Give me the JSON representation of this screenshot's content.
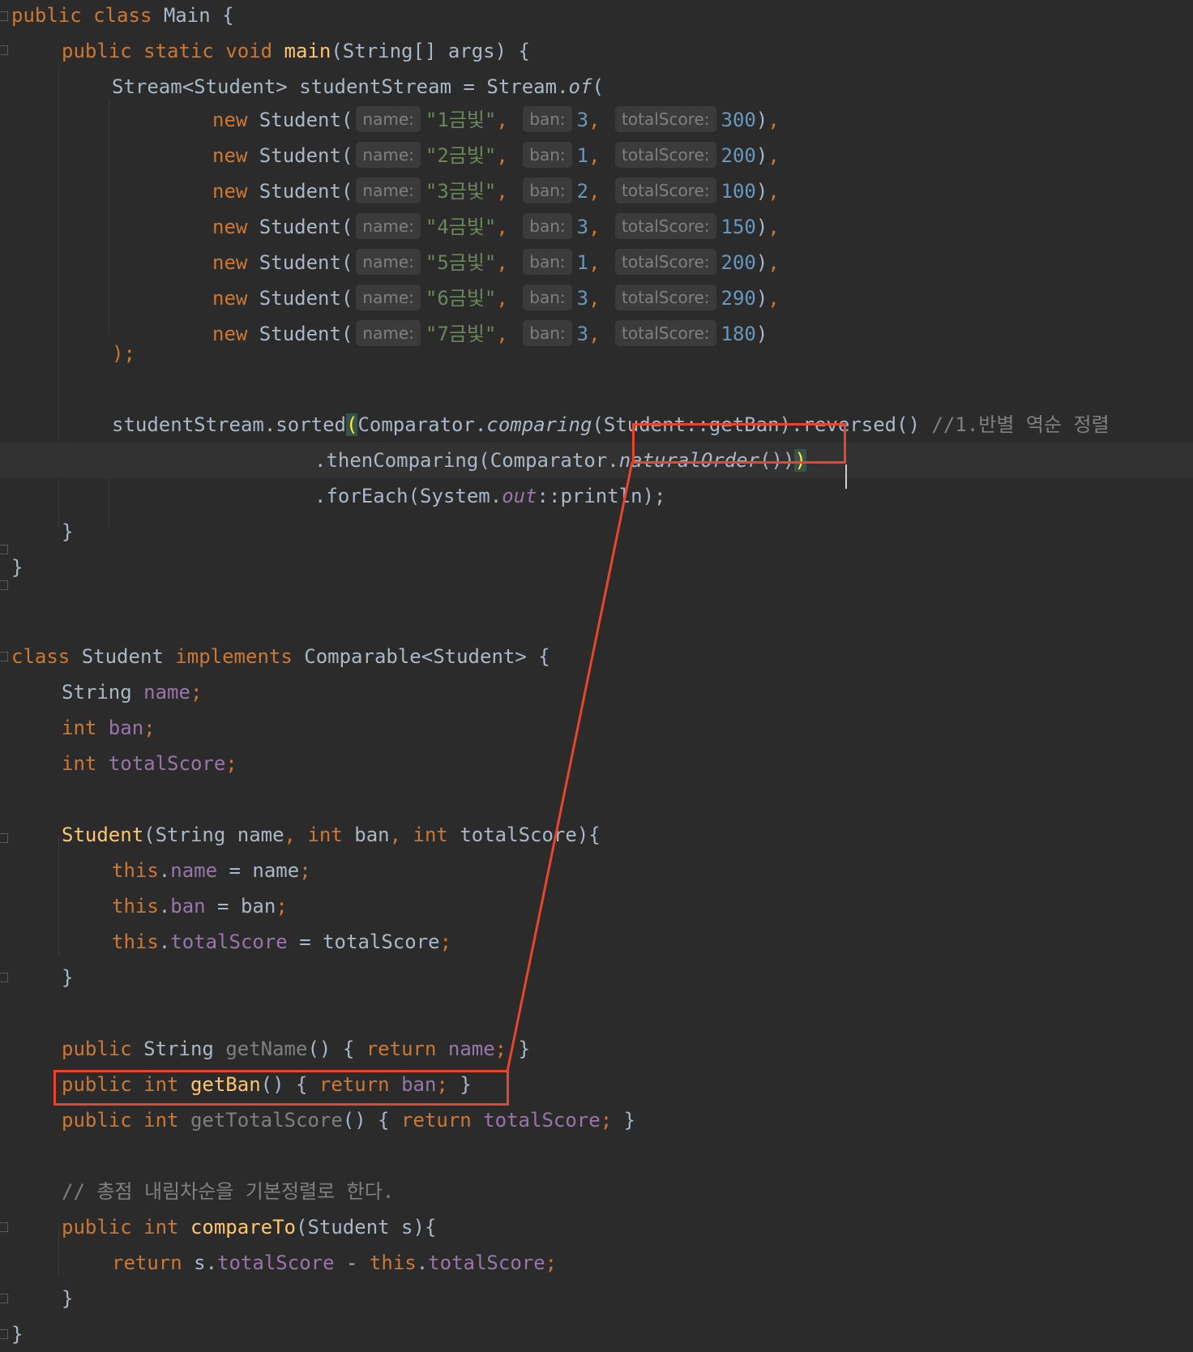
{
  "code": {
    "main_class_decl": {
      "kw": "public class ",
      "name": "Main",
      "open": " {"
    },
    "main_method": {
      "kw": "public static void ",
      "name": "main",
      "params": "(String[] args) {"
    },
    "stream_decl": {
      "lhs": "Stream<Student> studentStream = Stream.",
      "of": "of",
      "open": "("
    },
    "hints": {
      "name": "name:",
      "ban": "ban:",
      "totalScore": "totalScore:"
    },
    "student_ctor_calls": [
      {
        "kw": "new",
        "ctor": " Student(",
        "name": "\"1금빛\"",
        "ban": "3",
        "score": "300",
        "end": "),"
      },
      {
        "kw": "new",
        "ctor": " Student(",
        "name": "\"2금빛\"",
        "ban": "1",
        "score": "200",
        "end": "),"
      },
      {
        "kw": "new",
        "ctor": " Student(",
        "name": "\"3금빛\"",
        "ban": "2",
        "score": "100",
        "end": "),"
      },
      {
        "kw": "new",
        "ctor": " Student(",
        "name": "\"4금빛\"",
        "ban": "3",
        "score": "150",
        "end": "),"
      },
      {
        "kw": "new",
        "ctor": " Student(",
        "name": "\"5금빛\"",
        "ban": "1",
        "score": "200",
        "end": "),"
      },
      {
        "kw": "new",
        "ctor": " Student(",
        "name": "\"6금빛\"",
        "ban": "3",
        "score": "290",
        "end": "),"
      },
      {
        "kw": "new",
        "ctor": " Student(",
        "name": "\"7금빛\"",
        "ban": "3",
        "score": "180",
        "end": ")"
      }
    ],
    "stream_close": ");",
    "sorted_line": {
      "head": "studentStream.sorted",
      "paren": "(",
      "comparator": "Comparator.",
      "comparing": "comparing",
      "ref": "(Student::getBan)",
      "reversed": ".reversed() ",
      "comment": "//1.반별 역순 정렬"
    },
    "then_line": {
      "head": ".thenComparing(Comparator.",
      "natural": "naturalOrder",
      "tail": "())",
      "paren": ")"
    },
    "foreach_line": {
      "head": ".forEach(System.",
      "out": "out",
      "tail": "::println);"
    },
    "close_brace": "}",
    "student_class_decl": {
      "kw1": "class ",
      "name": "Student ",
      "kw2": "implements ",
      "iface": "Comparable<Student> {"
    },
    "fields": [
      {
        "type": "String ",
        "name": "name",
        "end": ";"
      },
      {
        "type": "int ",
        "name": "ban",
        "end": ";"
      },
      {
        "type": "int ",
        "name": "totalScore",
        "end": ";"
      }
    ],
    "ctor_decl": {
      "name": "Student",
      "p1": "(String name",
      "c1": ", ",
      "kw1": "int",
      "p2": " ban",
      "c2": ", ",
      "kw2": "int",
      "p3": " totalScore){"
    },
    "ctor_body": [
      {
        "this": "this",
        "dot": ".",
        "field": "name",
        "rhs": " = name",
        "end": ";"
      },
      {
        "this": "this",
        "dot": ".",
        "field": "ban",
        "rhs": " = ban",
        "end": ";"
      },
      {
        "this": "this",
        "dot": ".",
        "field": "totalScore",
        "rhs": " = totalScore",
        "end": ";"
      }
    ],
    "getters": [
      {
        "kw": "public ",
        "type": "String ",
        "name": "getName",
        "mid": "() { ",
        "ret": "return ",
        "field": "name",
        "end": "; }"
      },
      {
        "kw": "public int ",
        "type": "",
        "name": "getBan",
        "mid": "() { ",
        "ret": "return ",
        "field": "ban",
        "end": "; }"
      },
      {
        "kw": "public int ",
        "type": "",
        "name": "getTotalScore",
        "mid": "() { ",
        "ret": "return ",
        "field": "totalScore",
        "end": "; }"
      }
    ],
    "compare_comment": "// 총점 내림차순을 기본정렬로 한다.",
    "compare_decl": {
      "kw": "public int ",
      "name": "compareTo",
      "params": "(Student s){"
    },
    "compare_body": {
      "ret": "return ",
      "s": "s.",
      "f1": "totalScore",
      "minus": " - ",
      "this": "this",
      "dot": ".",
      "f2": "totalScore",
      "end": ";"
    }
  },
  "colors": {
    "background": "#2b2b2b",
    "keyword": "#cc7832",
    "method": "#ffc66d",
    "string": "#6a8759",
    "number": "#6897bb",
    "field": "#9876aa",
    "text": "#a9b7c6",
    "comment": "#808080",
    "annotation": "#e8452d"
  }
}
